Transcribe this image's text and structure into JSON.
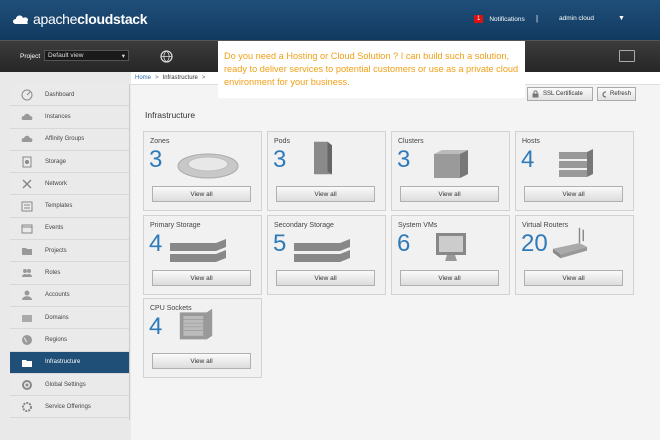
{
  "header": {
    "logo_text_light": "apache",
    "logo_text_bold": "cloudstack",
    "notification_count": "1",
    "notifications_label": "Notifications",
    "separator": "|",
    "user": "admin cloud",
    "user_caret": "▼"
  },
  "projectbar": {
    "label": "Project",
    "selected": "Default view",
    "caret": "▾"
  },
  "promo": "Do you need a Hosting or Cloud Solution ? I can build such a solution, ready to deliver services to potential customers or use as a private cloud environment for your business.",
  "breadcrumb": {
    "home": "Home",
    "sep": ">",
    "current": "Infrastructure",
    "sep2": ">"
  },
  "actions": {
    "ssl": "SSL Certificate",
    "refresh": "Refresh"
  },
  "page_title": "Infrastructure",
  "sidebar": {
    "items": [
      {
        "label": "Dashboard",
        "icon": "dashboard-icon"
      },
      {
        "label": "Instances",
        "icon": "instances-icon"
      },
      {
        "label": "Affinity Groups",
        "icon": "affinity-icon"
      },
      {
        "label": "Storage",
        "icon": "storage-icon"
      },
      {
        "label": "Network",
        "icon": "network-icon"
      },
      {
        "label": "Templates",
        "icon": "templates-icon"
      },
      {
        "label": "Events",
        "icon": "events-icon"
      },
      {
        "label": "Projects",
        "icon": "projects-icon"
      },
      {
        "label": "Roles",
        "icon": "roles-icon"
      },
      {
        "label": "Accounts",
        "icon": "accounts-icon"
      },
      {
        "label": "Domains",
        "icon": "domains-icon"
      },
      {
        "label": "Regions",
        "icon": "regions-icon"
      },
      {
        "label": "Infrastructure",
        "icon": "infrastructure-icon"
      },
      {
        "label": "Global Settings",
        "icon": "settings-icon"
      },
      {
        "label": "Service Offerings",
        "icon": "offerings-icon"
      }
    ]
  },
  "tiles": [
    {
      "label": "Zones",
      "count": "3",
      "button": "View all"
    },
    {
      "label": "Pods",
      "count": "3",
      "button": "View all"
    },
    {
      "label": "Clusters",
      "count": "3",
      "button": "View all"
    },
    {
      "label": "Hosts",
      "count": "4",
      "button": "View all"
    },
    {
      "label": "Primary Storage",
      "count": "4",
      "button": "View all"
    },
    {
      "label": "Secondary Storage",
      "count": "5",
      "button": "View all"
    },
    {
      "label": "System VMs",
      "count": "6",
      "button": "View all"
    },
    {
      "label": "Virtual Routers",
      "count": "20",
      "button": "View all"
    },
    {
      "label": "CPU Sockets",
      "count": "4",
      "button": "View all"
    }
  ],
  "colors": {
    "brand": "#1f4e76",
    "accent": "#2f7ab9",
    "promo_text": "#f0a017"
  }
}
